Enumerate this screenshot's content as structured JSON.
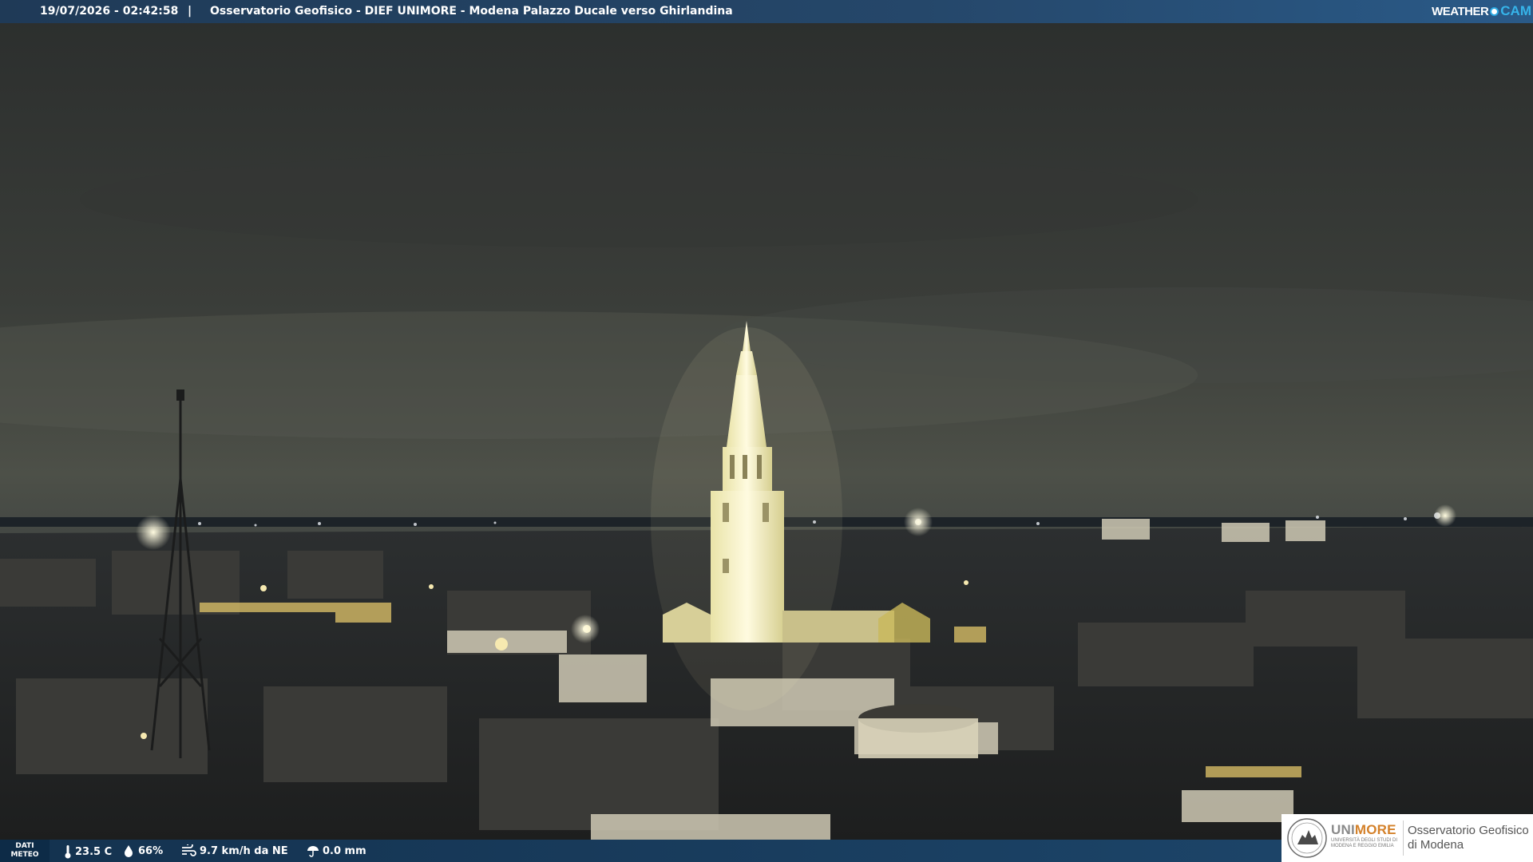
{
  "header": {
    "timestamp": "19/07/2026 - 02:42:58",
    "separator": "|",
    "camera_title": "Osservatorio Geofisico - DIEF UNIMORE - Modena Palazzo Ducale verso Ghirlandina",
    "brand_weather": "WEATHER",
    "brand_cam": "CAM"
  },
  "weather": {
    "badge_line1": "DATI",
    "badge_line2": "METEO",
    "temperature": "23.5 C",
    "humidity": "66%",
    "wind": "9.7 km/h da NE",
    "rain": "0.0 mm"
  },
  "logo": {
    "unimore_a": "UNI",
    "unimore_b": "MORE",
    "university_sub": "UNIVERSITÀ DEGLI STUDI DI MODENA E REGGIO EMILIA",
    "observatory_line1": "Osservatorio Geofisico",
    "observatory_line2": "di Modena"
  },
  "colors": {
    "bar": "#1f3a57",
    "accent": "#36b4ea",
    "unimore_orange": "#d4812a"
  }
}
